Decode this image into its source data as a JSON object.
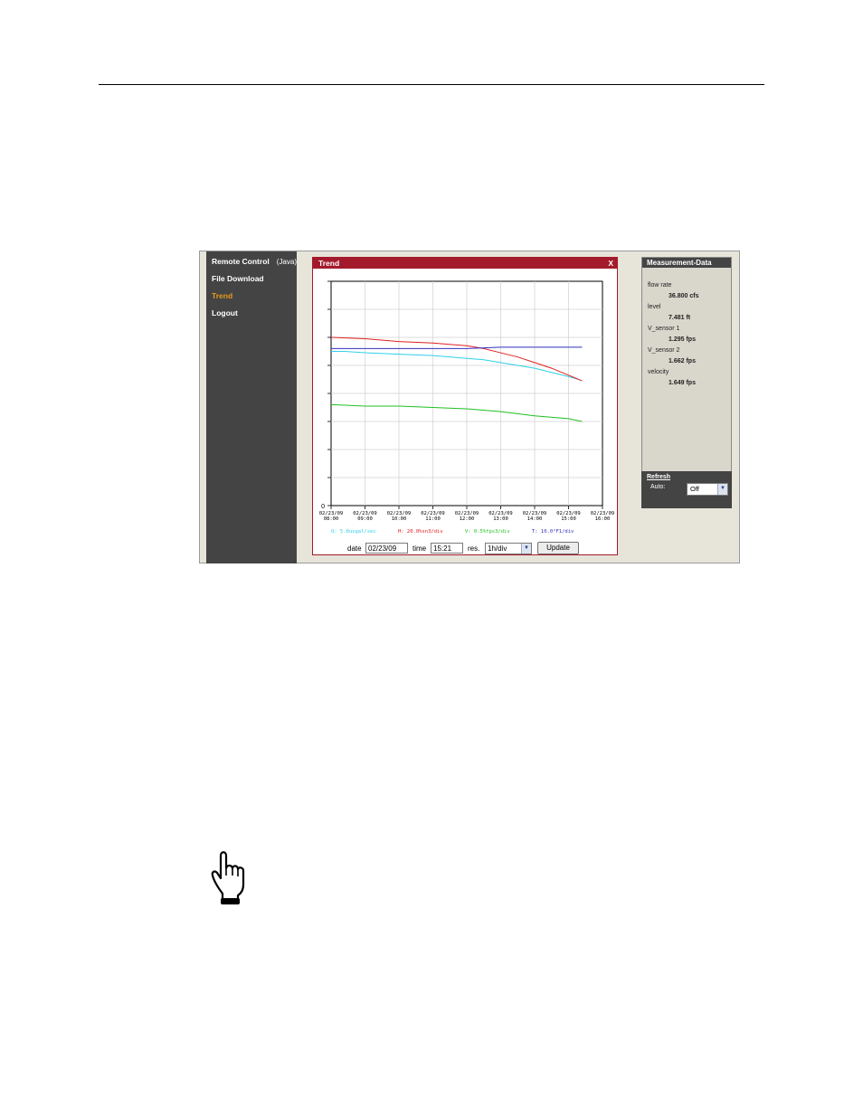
{
  "nav": {
    "items": [
      {
        "label": "Remote Control",
        "sub": "(Java)"
      },
      {
        "label": "File Download"
      },
      {
        "label": "Trend",
        "active": true
      },
      {
        "label": "Logout"
      }
    ]
  },
  "trend": {
    "title": "Trend",
    "close_label": "X",
    "date_label": "date",
    "date_value": "02/23/09",
    "time_label": "time",
    "time_value": "15:21",
    "res_label": "res.",
    "res_value": "1h/div",
    "update_label": "Update"
  },
  "measurement": {
    "title": "Measurement-Data",
    "items": [
      {
        "label": "flow rate",
        "value": "36.800 cfs"
      },
      {
        "label": "level",
        "value": "7.481 ft"
      },
      {
        "label": "V_sensor 1",
        "value": "1.295 fps"
      },
      {
        "label": "V_sensor 2",
        "value": "1.662 fps"
      },
      {
        "label": "velocity",
        "value": "1.649 fps"
      }
    ]
  },
  "refresh": {
    "link_label": "Refresh",
    "auto_label": "Auto:",
    "auto_value": "Off"
  },
  "chart_data": {
    "type": "line",
    "y_zero_label": "0",
    "ylim": [
      0,
      8
    ],
    "xlim": [
      0,
      8
    ],
    "grid": true,
    "x_ticks": [
      {
        "date": "02/23/09",
        "time": "08:00"
      },
      {
        "date": "02/23/09",
        "time": "09:00"
      },
      {
        "date": "02/23/09",
        "time": "10:00"
      },
      {
        "date": "02/23/09",
        "time": "11:00"
      },
      {
        "date": "02/23/09",
        "time": "12:00"
      },
      {
        "date": "02/23/09",
        "time": "13:00"
      },
      {
        "date": "02/23/09",
        "time": "14:00"
      },
      {
        "date": "02/23/09",
        "time": "15:00"
      },
      {
        "date": "02/23/09",
        "time": "16:00"
      }
    ],
    "legend": [
      {
        "text": "Q:  5.0usgal/sec",
        "color": "#2fd0e8"
      },
      {
        "text": "H:  20.0%sn3/div",
        "color": "#e02020"
      },
      {
        "text": "V:  0.5%fps3/div",
        "color": "#20c020"
      },
      {
        "text": "T:  10.0°F1/div",
        "color": "#3030c0"
      }
    ],
    "series": [
      {
        "color": "#2fd0e8",
        "x": [
          0,
          0.4,
          1,
          2,
          3,
          4,
          4.5,
          5,
          5.5,
          6,
          6.5,
          7,
          7.3
        ],
        "y": [
          5.5,
          5.5,
          5.45,
          5.4,
          5.35,
          5.25,
          5.2,
          5.1,
          5.0,
          4.9,
          4.75,
          4.6,
          4.5
        ]
      },
      {
        "color": "#e02020",
        "x": [
          0,
          1,
          2,
          3,
          4,
          4.5,
          5,
          5.5,
          6,
          6.5,
          7,
          7.4
        ],
        "y": [
          6.0,
          5.95,
          5.85,
          5.8,
          5.7,
          5.6,
          5.45,
          5.3,
          5.1,
          4.9,
          4.65,
          4.45
        ]
      },
      {
        "color": "#20c020",
        "x": [
          0,
          1,
          2,
          3,
          4,
          5,
          6,
          7,
          7.4
        ],
        "y": [
          3.6,
          3.55,
          3.55,
          3.5,
          3.45,
          3.35,
          3.2,
          3.1,
          3.0
        ]
      },
      {
        "color": "#3030c0",
        "x": [
          0,
          1,
          2,
          3,
          4,
          5,
          6,
          7,
          7.4
        ],
        "y": [
          5.6,
          5.6,
          5.6,
          5.6,
          5.6,
          5.65,
          5.65,
          5.65,
          5.65
        ]
      }
    ]
  }
}
